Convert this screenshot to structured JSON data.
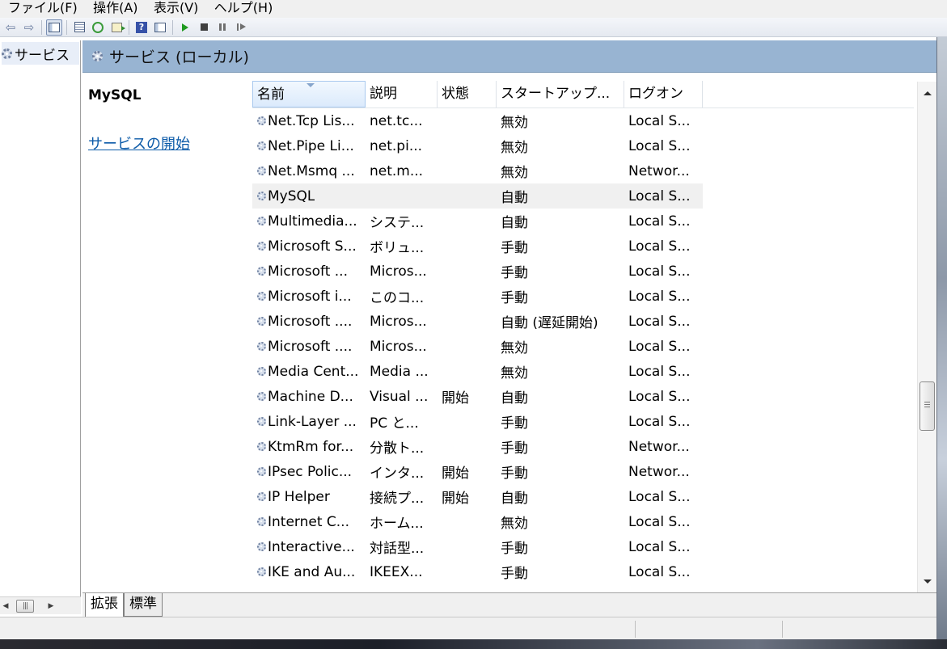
{
  "menu": [
    "ファイル(F)",
    "操作(A)",
    "表示(V)",
    "ヘルプ(H)"
  ],
  "tree": {
    "root_label": "サービス"
  },
  "header": {
    "title": "サービス (ローカル)"
  },
  "detail": {
    "service_name": "MySQL",
    "start_link": "サービスの開始"
  },
  "columns": {
    "name": "名前",
    "description": "説明",
    "status": "状態",
    "startup": "スタートアップ...",
    "logon": "ログオン"
  },
  "services": [
    {
      "name": "Net.Tcp Lis...",
      "description": "net.tc...",
      "status": "",
      "startup": "無効",
      "logon": "Local S..."
    },
    {
      "name": "Net.Pipe Li...",
      "description": "net.pi...",
      "status": "",
      "startup": "無効",
      "logon": "Local S..."
    },
    {
      "name": "Net.Msmq ...",
      "description": "net.m...",
      "status": "",
      "startup": "無効",
      "logon": "Networ..."
    },
    {
      "name": "MySQL",
      "description": "",
      "status": "",
      "startup": "自動",
      "logon": "Local S...",
      "selected": true
    },
    {
      "name": "Multimedia...",
      "description": "システ...",
      "status": "",
      "startup": "自動",
      "logon": "Local S..."
    },
    {
      "name": "Microsoft S...",
      "description": "ボリュ...",
      "status": "",
      "startup": "手動",
      "logon": "Local S..."
    },
    {
      "name": "Microsoft ...",
      "description": "Micros...",
      "status": "",
      "startup": "手動",
      "logon": "Local S..."
    },
    {
      "name": "Microsoft i...",
      "description": "このコ...",
      "status": "",
      "startup": "手動",
      "logon": "Local S..."
    },
    {
      "name": "Microsoft ....",
      "description": "Micros...",
      "status": "",
      "startup": "自動 (遅延開始)",
      "logon": "Local S..."
    },
    {
      "name": "Microsoft ....",
      "description": "Micros...",
      "status": "",
      "startup": "無効",
      "logon": "Local S..."
    },
    {
      "name": "Media Cent...",
      "description": "Media ...",
      "status": "",
      "startup": "無効",
      "logon": "Local S..."
    },
    {
      "name": "Machine D...",
      "description": "Visual ...",
      "status": "開始",
      "startup": "自動",
      "logon": "Local S..."
    },
    {
      "name": "Link-Layer ...",
      "description": "PC と...",
      "status": "",
      "startup": "手動",
      "logon": "Local S..."
    },
    {
      "name": "KtmRm for...",
      "description": "分散ト...",
      "status": "",
      "startup": "手動",
      "logon": "Networ..."
    },
    {
      "name": "IPsec Polic...",
      "description": "インタ...",
      "status": "開始",
      "startup": "手動",
      "logon": "Networ..."
    },
    {
      "name": "IP Helper",
      "description": "接続プ...",
      "status": "開始",
      "startup": "自動",
      "logon": "Local S..."
    },
    {
      "name": "Internet C...",
      "description": "ホーム...",
      "status": "",
      "startup": "無効",
      "logon": "Local S..."
    },
    {
      "name": "Interactive...",
      "description": "対話型...",
      "status": "",
      "startup": "手動",
      "logon": "Local S..."
    },
    {
      "name": "IKE and Au...",
      "description": "IKEEX...",
      "status": "",
      "startup": "手動",
      "logon": "Local S..."
    }
  ],
  "tabs": {
    "extended": "拡張",
    "standard": "標準"
  },
  "icons": {
    "service": "gear-icon",
    "help": "help-icon"
  },
  "colors": {
    "header_bg": "#98b4d2",
    "link": "#0b5aa8",
    "selected_row": "#f0f0f0"
  }
}
